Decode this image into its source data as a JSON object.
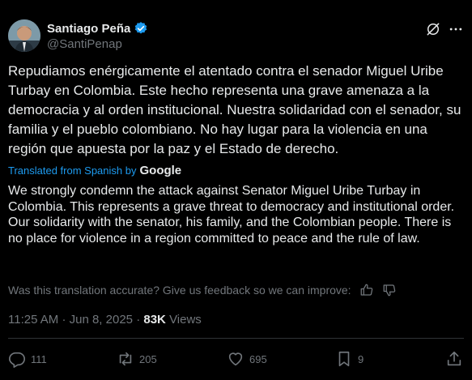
{
  "author": {
    "name": "Santiago Peña",
    "handle": "@SantiPenap",
    "verified": true
  },
  "icons": {
    "verified": "verified-badge-icon",
    "grok": "grok-icon",
    "more": "more-icon",
    "google": "google-logo",
    "thumbs_up": "thumbs-up-icon",
    "thumbs_down": "thumbs-down-icon",
    "reply": "reply-icon",
    "repost": "repost-icon",
    "like": "like-icon",
    "bookmark": "bookmark-icon",
    "share": "share-icon"
  },
  "tweet": {
    "original_text": "Repudiamos enérgicamente el atentado contra el senador Miguel Uribe Turbay en Colombia. Este hecho representa una grave amenaza a la democracia y al orden institucional. Nuestra solidaridad con el senador, su familia y el pueblo colombiano. No hay lugar para la violencia en una región que apuesta por la paz y el Estado de derecho.",
    "translated_from": "Translated from Spanish by",
    "translator": "Google",
    "translation_text": "We strongly condemn the attack against Senator Miguel Uribe Turbay in Colombia. This represents a grave threat to democracy and institutional order. Our solidarity with the senator, his family, and the Colombian people. There is no place for violence in a region committed to peace and the rule of law.",
    "feedback_prompt": "Was this translation accurate? Give us feedback so we can improve:"
  },
  "meta": {
    "time": "11:25 AM",
    "separator": "·",
    "date": "Jun 8, 2025",
    "views_count": "83K",
    "views_label": "Views"
  },
  "actions": {
    "replies": "111",
    "reposts": "205",
    "likes": "695",
    "bookmarks": "9"
  },
  "colors": {
    "background": "#000000",
    "text": "#e7e9ea",
    "muted": "#71767b",
    "accent": "#1d9bf0"
  }
}
